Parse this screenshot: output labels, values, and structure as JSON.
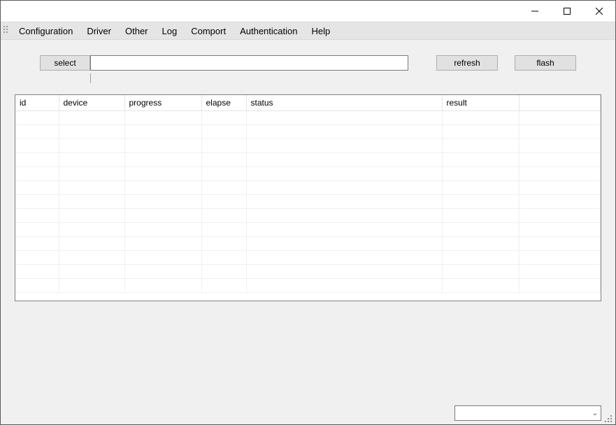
{
  "window_controls": {
    "minimize": "minimize",
    "maximize": "maximize",
    "close": "close"
  },
  "menu": {
    "items": [
      {
        "label": "Configuration"
      },
      {
        "label": "Driver"
      },
      {
        "label": "Other"
      },
      {
        "label": "Log"
      },
      {
        "label": "Comport"
      },
      {
        "label": "Authentication"
      },
      {
        "label": "Help"
      }
    ]
  },
  "toolbar": {
    "select_label": "select",
    "path_value": "",
    "refresh_label": "refresh",
    "flash_label": "flash"
  },
  "table": {
    "columns": [
      "id",
      "device",
      "progress",
      "elapse",
      "status",
      "result",
      ""
    ],
    "rows": [
      [
        "",
        "",
        "",
        "",
        "",
        "",
        ""
      ],
      [
        "",
        "",
        "",
        "",
        "",
        "",
        ""
      ],
      [
        "",
        "",
        "",
        "",
        "",
        "",
        ""
      ],
      [
        "",
        "",
        "",
        "",
        "",
        "",
        ""
      ],
      [
        "",
        "",
        "",
        "",
        "",
        "",
        ""
      ],
      [
        "",
        "",
        "",
        "",
        "",
        "",
        ""
      ],
      [
        "",
        "",
        "",
        "",
        "",
        "",
        ""
      ],
      [
        "",
        "",
        "",
        "",
        "",
        "",
        ""
      ],
      [
        "",
        "",
        "",
        "",
        "",
        "",
        ""
      ],
      [
        "",
        "",
        "",
        "",
        "",
        "",
        ""
      ],
      [
        "",
        "",
        "",
        "",
        "",
        "",
        ""
      ],
      [
        "",
        "",
        "",
        "",
        "",
        "",
        ""
      ],
      [
        "",
        "",
        "",
        "",
        "",
        "",
        ""
      ]
    ]
  },
  "statusbar": {
    "combo_value": ""
  }
}
